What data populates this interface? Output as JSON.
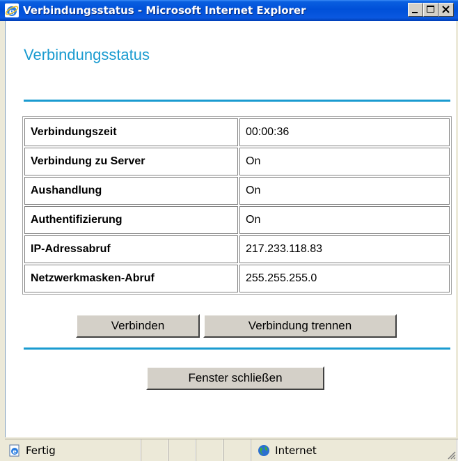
{
  "window": {
    "title": "Verbindungsstatus - Microsoft Internet Explorer"
  },
  "page": {
    "heading": "Verbindungsstatus"
  },
  "status_table": {
    "rows": [
      {
        "label": "Verbindungszeit",
        "value": "00:00:36"
      },
      {
        "label": "Verbindung zu Server",
        "value": "On"
      },
      {
        "label": "Aushandlung",
        "value": "On"
      },
      {
        "label": "Authentifizierung",
        "value": "On"
      },
      {
        "label": "IP-Adressabruf",
        "value": "217.233.118.83"
      },
      {
        "label": "Netzwerkmasken-Abruf",
        "value": "255.255.255.0"
      }
    ]
  },
  "buttons": {
    "connect": "Verbinden",
    "disconnect": "Verbindung trennen",
    "close": "Fenster schließen"
  },
  "statusbar": {
    "status": "Fertig",
    "zone": "Internet"
  },
  "colors": {
    "accent": "#1a9bd0",
    "titlebar": "#0050d8"
  }
}
